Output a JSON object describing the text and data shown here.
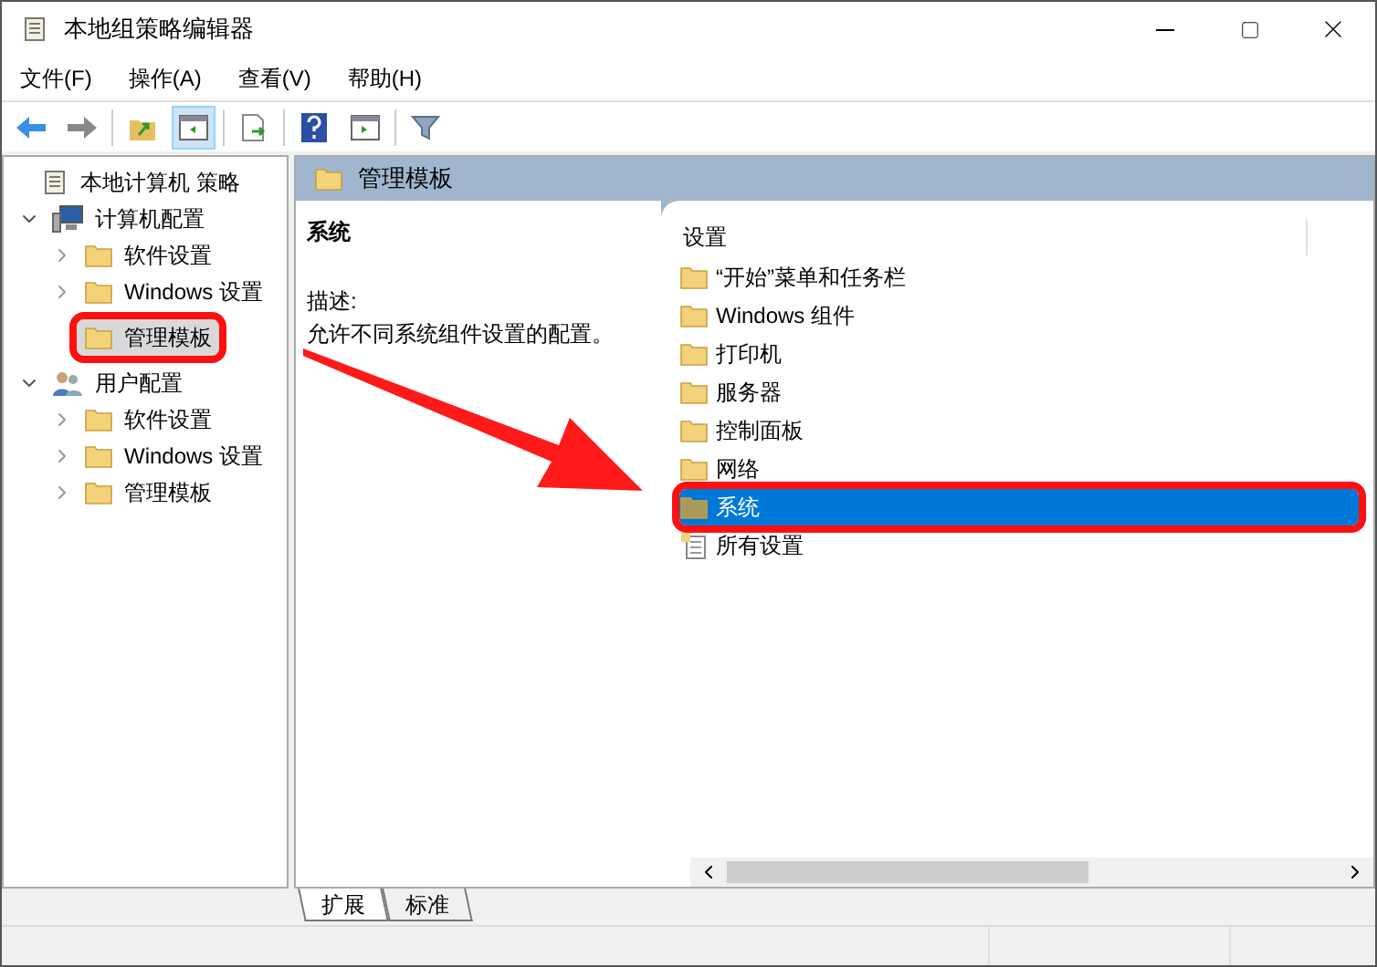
{
  "window": {
    "title": "本地组策略编辑器"
  },
  "menu": [
    "文件(F)",
    "操作(A)",
    "查看(V)",
    "帮助(H)"
  ],
  "tree": [
    {
      "label": "本地计算机 策略",
      "kind": "policy",
      "selected": false,
      "annotated": false,
      "children": [
        {
          "label": "计算机配置",
          "kind": "computer",
          "expanded": true,
          "selected": false,
          "annotated": false,
          "children": [
            {
              "label": "软件设置",
              "kind": "folder",
              "expanded": false,
              "selected": false,
              "annotated": false
            },
            {
              "label": "Windows 设置",
              "kind": "folder",
              "expanded": false,
              "selected": false,
              "annotated": false
            },
            {
              "label": "管理模板",
              "kind": "folder",
              "selected": true,
              "annotated": true
            }
          ]
        },
        {
          "label": "用户配置",
          "kind": "user",
          "expanded": true,
          "selected": false,
          "annotated": false,
          "children": [
            {
              "label": "软件设置",
              "kind": "folder",
              "expanded": false,
              "selected": false,
              "annotated": false
            },
            {
              "label": "Windows 设置",
              "kind": "folder",
              "expanded": false,
              "selected": false,
              "annotated": false
            },
            {
              "label": "管理模板",
              "kind": "folder",
              "expanded": false,
              "selected": false,
              "annotated": false
            }
          ]
        }
      ]
    }
  ],
  "header": {
    "title": "管理模板"
  },
  "detail": {
    "title": "系统",
    "description_label": "描述:",
    "description": "允许不同系统组件设置的配置。"
  },
  "list": {
    "column": "设置",
    "items": [
      {
        "label": "“开始”菜单和任务栏",
        "kind": "folder",
        "selected": false,
        "annotated": false
      },
      {
        "label": "Windows 组件",
        "kind": "folder",
        "selected": false,
        "annotated": false
      },
      {
        "label": "打印机",
        "kind": "folder",
        "selected": false,
        "annotated": false
      },
      {
        "label": "服务器",
        "kind": "folder",
        "selected": false,
        "annotated": false
      },
      {
        "label": "控制面板",
        "kind": "folder",
        "selected": false,
        "annotated": false
      },
      {
        "label": "网络",
        "kind": "folder",
        "selected": false,
        "annotated": false
      },
      {
        "label": "系统",
        "kind": "folder",
        "selected": true,
        "annotated": true
      },
      {
        "label": "所有设置",
        "kind": "settings",
        "selected": false,
        "annotated": false
      }
    ]
  },
  "tabs": [
    {
      "label": "扩展",
      "selected": true
    },
    {
      "label": "标准",
      "selected": false
    }
  ]
}
